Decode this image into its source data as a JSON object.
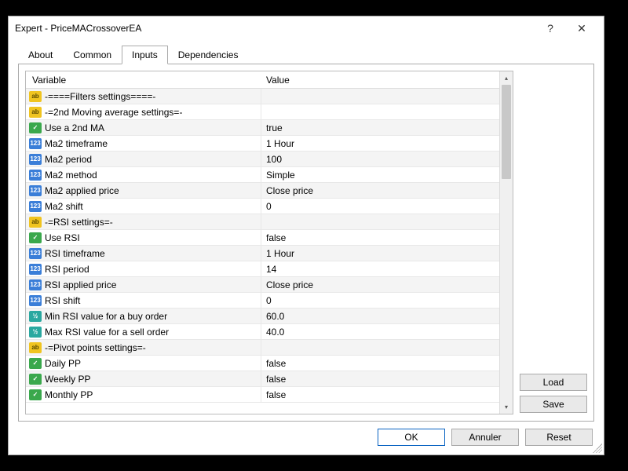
{
  "title": "Expert - PriceMACrossoverEA",
  "tabs": [
    "About",
    "Common",
    "Inputs",
    "Dependencies"
  ],
  "activeTab": 2,
  "columns": {
    "variable": "Variable",
    "value": "Value"
  },
  "rows": [
    {
      "icon": "ab",
      "label": "-====Filters settings====-",
      "value": ""
    },
    {
      "icon": "ab",
      "label": "-=2nd Moving average settings=-",
      "value": ""
    },
    {
      "icon": "bool",
      "label": "Use a 2nd MA",
      "value": "true"
    },
    {
      "icon": "int",
      "label": "Ma2 timeframe",
      "value": "1 Hour"
    },
    {
      "icon": "int",
      "label": "Ma2 period",
      "value": "100"
    },
    {
      "icon": "int",
      "label": "Ma2 method",
      "value": "Simple"
    },
    {
      "icon": "int",
      "label": "Ma2 applied price",
      "value": "Close price"
    },
    {
      "icon": "int",
      "label": "Ma2 shift",
      "value": "0"
    },
    {
      "icon": "ab",
      "label": "-=RSI settings=-",
      "value": ""
    },
    {
      "icon": "bool",
      "label": "Use RSI",
      "value": "false"
    },
    {
      "icon": "int",
      "label": "RSI timeframe",
      "value": "1 Hour"
    },
    {
      "icon": "int",
      "label": "RSI period",
      "value": "14"
    },
    {
      "icon": "int",
      "label": "RSI applied price",
      "value": "Close price"
    },
    {
      "icon": "int",
      "label": "RSI shift",
      "value": "0"
    },
    {
      "icon": "float",
      "label": "Min RSI value for a buy order",
      "value": "60.0"
    },
    {
      "icon": "float",
      "label": "Max RSI value for a sell order",
      "value": "40.0"
    },
    {
      "icon": "ab",
      "label": "-=Pivot points settings=-",
      "value": ""
    },
    {
      "icon": "bool",
      "label": "Daily PP",
      "value": "false"
    },
    {
      "icon": "bool",
      "label": "Weekly PP",
      "value": "false"
    },
    {
      "icon": "bool",
      "label": "Monthly PP",
      "value": "false"
    }
  ],
  "iconText": {
    "ab": "ab",
    "bool": "✓",
    "int": "123",
    "float": "½"
  },
  "sideButtons": {
    "load": "Load",
    "save": "Save"
  },
  "footerButtons": {
    "ok": "OK",
    "cancel": "Annuler",
    "reset": "Reset"
  }
}
